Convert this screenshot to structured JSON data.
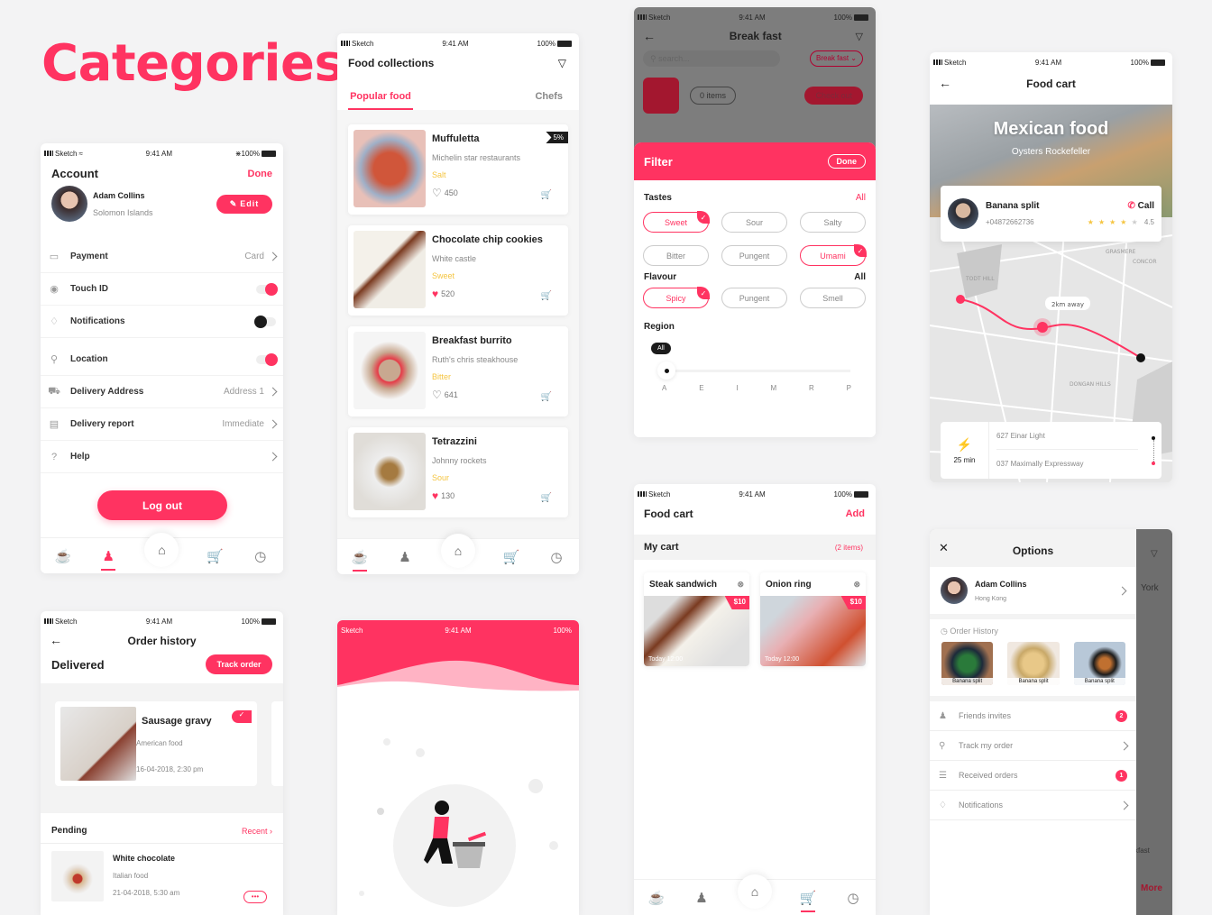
{
  "page_title": "Categories",
  "status": {
    "carrier": "Sketch",
    "time": "9:41 AM",
    "battery": "100%"
  },
  "account": {
    "title": "Account",
    "done": "Done",
    "user_name": "Adam Collins",
    "user_location": "Solomon Islands",
    "edit": "Edit",
    "settings": [
      {
        "label": "Payment",
        "value": "Card",
        "icon": "card-icon",
        "control": "chevron"
      },
      {
        "label": "Touch ID",
        "value": "",
        "icon": "fingerprint-icon",
        "control": "toggle-on"
      },
      {
        "label": "Notifications",
        "value": "",
        "icon": "bell-icon",
        "control": "toggle-off"
      },
      {
        "label": "Location",
        "value": "",
        "icon": "location-pin-icon",
        "control": "toggle-on"
      },
      {
        "label": "Delivery Address",
        "value": "Address 1",
        "icon": "truck-icon",
        "control": "chevron"
      },
      {
        "label": "Delivery report",
        "value": "Immediate",
        "icon": "report-icon",
        "control": "chevron"
      },
      {
        "label": "Help",
        "value": "",
        "icon": "help-icon",
        "control": "chevron"
      }
    ],
    "logout": "Log out"
  },
  "collections": {
    "title": "Food collections",
    "tabs": [
      "Popular food",
      "Chefs"
    ],
    "items": [
      {
        "name": "Muffuletta",
        "source": "Michelin star restaurants",
        "taste": "Salt",
        "likes": "450",
        "liked": false,
        "discount": "5%"
      },
      {
        "name": "Chocolate chip cookies",
        "source": "White castle",
        "taste": "Sweet",
        "likes": "520",
        "liked": true,
        "discount": ""
      },
      {
        "name": "Breakfast burrito",
        "source": "Ruth's chris steakhouse",
        "taste": "Bitter",
        "likes": "641",
        "liked": false,
        "discount": ""
      },
      {
        "name": "Tetrazzini",
        "source": "Johnny rockets",
        "taste": "Sour",
        "likes": "130",
        "liked": true,
        "discount": ""
      }
    ]
  },
  "filter": {
    "header_title": "Break fast",
    "search_placeholder": "search...",
    "category": "Break fast",
    "items_count": "0 items",
    "checkout": "Check out",
    "title": "Filter",
    "done": "Done",
    "tastes_label": "Tastes",
    "tastes_all": "All",
    "tastes": [
      {
        "label": "Sweet",
        "selected": true
      },
      {
        "label": "Sour",
        "selected": false
      },
      {
        "label": "Salty",
        "selected": false
      },
      {
        "label": "Bitter",
        "selected": false
      },
      {
        "label": "Pungent",
        "selected": false
      },
      {
        "label": "Umami",
        "selected": true
      }
    ],
    "flavour_label": "Flavour",
    "flavour_all": "All",
    "flavours": [
      {
        "label": "Spicy",
        "selected": true
      },
      {
        "label": "Pungent",
        "selected": false
      },
      {
        "label": "Smell",
        "selected": false
      }
    ],
    "region_label": "Region",
    "region_tooltip": "All",
    "region_ticks": [
      "A",
      "E",
      "I",
      "M",
      "R",
      "P"
    ],
    "region_value_index": 0
  },
  "tracking": {
    "title": "Food cart",
    "hero_title": "Mexican food",
    "hero_subtitle": "Oysters Rockefeller",
    "courier_name": "Banana split",
    "courier_phone": "+04872662736",
    "call": "Call",
    "rating": "4.5",
    "rating_value": 4.5,
    "distance": "2km away",
    "map_labels": [
      "GRASMERE",
      "CONCOR",
      "TODT HILL",
      "DONGAN HILLS"
    ],
    "eta": "25 min",
    "from": "627 Einar Light",
    "to": "037 Maximally Expressway"
  },
  "order_history": {
    "title": "Order history",
    "delivered": "Delivered",
    "track": "Track order",
    "delivered_item": {
      "name": "Sausage gravy",
      "type": "American food",
      "date": "16-04-2018, 2:30 pm"
    },
    "pending": "Pending",
    "recent": "Recent",
    "pending_item": {
      "name": "White chocolate",
      "type": "Italian food",
      "date": "21-04-2018, 5:30 am"
    }
  },
  "cart": {
    "title": "Food cart",
    "add": "Add",
    "my_cart": "My cart",
    "count": "(2 items)",
    "items": [
      {
        "name": "Steak sandwich",
        "price": "$10",
        "time": "Today 12:00"
      },
      {
        "name": "Onion ring",
        "price": "$10",
        "time": "Today 12:00"
      }
    ]
  },
  "options": {
    "title": "Options",
    "user_name": "Adam Collins",
    "user_location": "Hong Kong",
    "history_label": "Order History",
    "history": [
      "Banana split",
      "Banana split",
      "Banana split"
    ],
    "menu": [
      {
        "label": "Friends invites",
        "icon": "friends-icon",
        "badge": "2"
      },
      {
        "label": "Track my order",
        "icon": "track-icon",
        "badge": ""
      },
      {
        "label": "Received orders",
        "icon": "list-icon",
        "badge": "1"
      },
      {
        "label": "Notifications",
        "icon": "bell-icon",
        "badge": ""
      }
    ],
    "behind_texts": [
      "York",
      "kfast",
      "More"
    ]
  },
  "colors": {
    "accent": "#ff3361",
    "taste": "#f5c542",
    "bg": "#f3f3f4"
  }
}
